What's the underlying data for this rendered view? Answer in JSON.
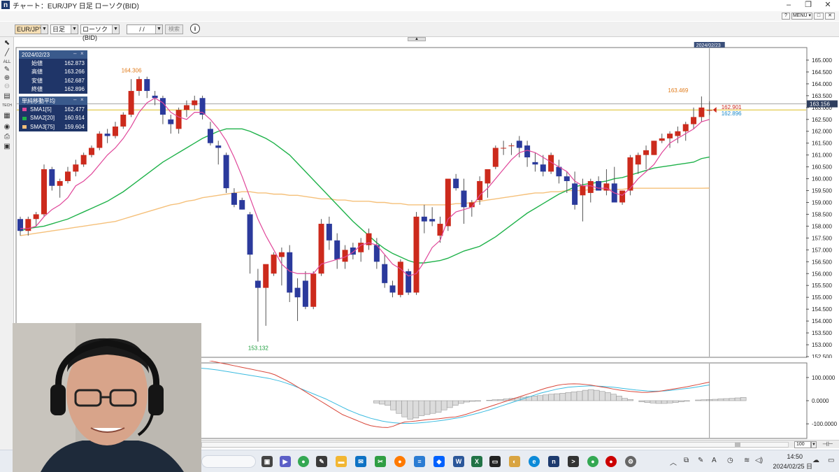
{
  "window": {
    "title": "チャート：EUR/JPY 日足 ローソク(BID)",
    "controls": [
      "?",
      "MENU ▾",
      "□",
      "✕"
    ]
  },
  "toolbar": {
    "symbol": "EUR/JPY",
    "timeframe": "日足",
    "chart_type": "ローソク(BID)",
    "date": "/ /",
    "search_label": "検索",
    "info_icon": "info-icon"
  },
  "ohlc_panel": {
    "date": "2024/02/23",
    "rows": [
      {
        "label": "始値",
        "value": "162.873"
      },
      {
        "label": "高値",
        "value": "163.266"
      },
      {
        "label": "安値",
        "value": "162.687"
      },
      {
        "label": "終値",
        "value": "162.896"
      }
    ]
  },
  "sma_panel": {
    "title": "単純移動平均",
    "rows": [
      {
        "label": "SMA1[5]",
        "value": "162.477",
        "color": "#e0479a"
      },
      {
        "label": "SMA2[20]",
        "value": "160.914",
        "color": "#1fb24a"
      },
      {
        "label": "SMA3[75]",
        "value": "159.604",
        "color": "#f5c07a"
      }
    ]
  },
  "chart_data": [
    {
      "type": "candlestick",
      "symbol": "EUR/JPY",
      "timeframe": "日足",
      "cursor_date_label": "2024/02/23",
      "ylim": [
        152.5,
        165.5
      ],
      "yticks": [
        "165.000",
        "164.500",
        "164.000",
        "163.500",
        "163.000",
        "162.500",
        "162.000",
        "161.500",
        "161.000",
        "160.500",
        "160.000",
        "159.500",
        "159.000",
        "158.500",
        "158.000",
        "157.500",
        "157.000",
        "156.500",
        "156.000",
        "155.500",
        "155.000",
        "154.500",
        "154.000",
        "153.500",
        "153.000",
        "152.500"
      ],
      "current_price_label": "163.156",
      "current_price": 163.156,
      "price_labels": {
        "close": "162.901",
        "sma": "162.896"
      },
      "annotations": [
        {
          "text": "164.306",
          "value": 164.306,
          "index": 14,
          "color": "#e07b1a"
        },
        {
          "text": "153.132",
          "value": 153.132,
          "index": 30,
          "color": "#1a9c3a"
        },
        {
          "text": "163.469",
          "value": 163.469,
          "index": 83,
          "color": "#e07b1a"
        }
      ],
      "up_color": "#cc2a1c",
      "down_color": "#2b3a9c",
      "candles": [
        [
          158.3,
          158.4,
          157.6,
          157.8
        ],
        [
          157.8,
          158.4,
          157.6,
          158.3
        ],
        [
          158.3,
          158.6,
          158.0,
          158.5
        ],
        [
          158.5,
          160.6,
          158.4,
          160.4
        ],
        [
          160.4,
          160.5,
          159.5,
          159.7
        ],
        [
          159.7,
          160.0,
          159.2,
          159.9
        ],
        [
          159.9,
          160.5,
          159.8,
          160.3
        ],
        [
          160.3,
          160.8,
          160.1,
          160.6
        ],
        [
          160.6,
          161.1,
          160.5,
          161.0
        ],
        [
          161.0,
          161.4,
          160.9,
          161.3
        ],
        [
          161.3,
          162.0,
          161.2,
          161.9
        ],
        [
          161.9,
          162.1,
          161.5,
          161.8
        ],
        [
          161.8,
          162.4,
          161.7,
          162.2
        ],
        [
          162.2,
          162.8,
          162.1,
          162.7
        ],
        [
          162.7,
          164.2,
          162.6,
          163.7
        ],
        [
          163.7,
          164.306,
          163.5,
          164.2
        ],
        [
          164.2,
          164.3,
          163.4,
          163.7
        ],
        [
          163.5,
          163.7,
          163.1,
          163.4
        ],
        [
          163.4,
          163.5,
          162.3,
          162.7
        ],
        [
          162.5,
          162.7,
          161.9,
          162.3
        ],
        [
          162.1,
          163.0,
          161.9,
          162.9
        ],
        [
          162.9,
          163.3,
          162.6,
          163.1
        ],
        [
          163.1,
          163.5,
          162.9,
          163.3
        ],
        [
          163.4,
          163.5,
          162.5,
          162.7
        ],
        [
          162.1,
          162.4,
          161.4,
          161.5
        ],
        [
          161.4,
          161.6,
          160.6,
          161.3
        ],
        [
          161.0,
          161.1,
          159.4,
          159.6
        ],
        [
          159.4,
          159.6,
          158.8,
          158.9
        ],
        [
          159.1,
          159.2,
          158.7,
          158.7
        ],
        [
          158.5,
          158.6,
          156.0,
          156.8
        ],
        [
          155.7,
          156.2,
          153.132,
          155.4
        ],
        [
          155.4,
          156.3,
          153.8,
          156.4
        ],
        [
          156.0,
          156.9,
          155.9,
          156.8
        ],
        [
          156.7,
          157.1,
          155.5,
          156.9
        ],
        [
          156.9,
          157.2,
          154.8,
          155.2
        ],
        [
          155.4,
          155.8,
          154.0,
          155.0
        ],
        [
          155.7,
          156.1,
          154.5,
          154.6
        ],
        [
          154.6,
          156.1,
          154.5,
          156.0
        ],
        [
          156.0,
          158.3,
          155.9,
          158.1
        ],
        [
          158.1,
          158.4,
          157.0,
          157.4
        ],
        [
          157.4,
          157.7,
          156.2,
          156.6
        ],
        [
          156.5,
          157.2,
          156.2,
          157.0
        ],
        [
          157.1,
          157.3,
          156.6,
          156.8
        ],
        [
          156.9,
          157.5,
          156.5,
          157.3
        ],
        [
          157.2,
          157.9,
          157.0,
          157.7
        ],
        [
          157.2,
          157.5,
          156.2,
          156.5
        ],
        [
          156.4,
          156.8,
          155.4,
          155.6
        ],
        [
          155.5,
          155.7,
          155.0,
          155.2
        ],
        [
          155.1,
          156.6,
          155.0,
          156.5
        ],
        [
          156.1,
          156.2,
          155.1,
          155.2
        ],
        [
          155.2,
          158.6,
          155.1,
          158.4
        ],
        [
          158.4,
          158.9,
          157.7,
          158.2
        ],
        [
          158.3,
          158.8,
          158.0,
          158.2
        ],
        [
          157.6,
          158.4,
          157.3,
          158.1
        ],
        [
          158.0,
          159.2,
          157.8,
          160.0
        ],
        [
          160.0,
          160.2,
          159.5,
          159.6
        ],
        [
          159.5,
          160.0,
          158.1,
          158.8
        ],
        [
          158.8,
          159.1,
          158.4,
          159.0
        ],
        [
          159.1,
          160.1,
          158.9,
          159.9
        ],
        [
          159.8,
          160.3,
          159.2,
          160.4
        ],
        [
          160.5,
          161.4,
          160.4,
          161.3
        ],
        [
          161.3,
          161.6,
          161.0,
          161.3
        ],
        [
          161.4,
          161.5,
          161.0,
          161.4
        ],
        [
          161.6,
          161.8,
          160.9,
          161.3
        ],
        [
          161.4,
          161.6,
          160.5,
          160.9
        ],
        [
          160.7,
          161.1,
          160.3,
          160.6
        ],
        [
          160.6,
          161.0,
          160.1,
          160.3
        ],
        [
          160.3,
          161.1,
          160.2,
          161.0
        ],
        [
          160.5,
          160.8,
          159.8,
          160.1
        ],
        [
          160.1,
          160.3,
          159.4,
          159.9
        ],
        [
          159.8,
          160.3,
          158.7,
          158.9
        ],
        [
          159.3,
          160.0,
          158.2,
          159.7
        ],
        [
          159.4,
          160.0,
          159.0,
          159.9
        ],
        [
          159.9,
          160.1,
          159.6,
          159.5
        ],
        [
          159.5,
          160.4,
          159.3,
          159.8
        ],
        [
          159.8,
          160.5,
          159.0,
          159.0
        ],
        [
          159.0,
          159.5,
          158.9,
          159.5
        ],
        [
          159.5,
          161.0,
          159.3,
          160.9
        ],
        [
          160.6,
          161.1,
          160.2,
          161.0
        ],
        [
          161.0,
          161.4,
          160.4,
          161.2
        ],
        [
          161.0,
          161.6,
          161.0,
          161.6
        ],
        [
          161.6,
          161.9,
          161.5,
          161.7
        ],
        [
          161.7,
          162.0,
          161.3,
          161.9
        ],
        [
          161.8,
          162.2,
          161.5,
          162.0
        ],
        [
          162.0,
          162.4,
          161.6,
          162.3
        ],
        [
          162.3,
          163.0,
          162.1,
          162.6
        ],
        [
          162.6,
          163.469,
          162.4,
          163.0
        ],
        [
          162.873,
          163.266,
          162.687,
          162.896
        ]
      ],
      "sma1": [
        157.9,
        157.9,
        158.0,
        158.4,
        158.7,
        158.9,
        159.2,
        159.7,
        159.9,
        160.2,
        160.6,
        161.0,
        161.3,
        161.7,
        162.2,
        162.8,
        163.2,
        163.4,
        163.2,
        162.8,
        162.6,
        162.5,
        162.8,
        162.8,
        162.5,
        162.1,
        161.6,
        160.9,
        160.1,
        159.2,
        158.3,
        157.6,
        157.0,
        156.4,
        156.1,
        156.0,
        156.0,
        156.0,
        156.4,
        156.5,
        156.6,
        156.7,
        156.9,
        157.2,
        157.3,
        157.2,
        156.8,
        156.4,
        156.2,
        155.9,
        156.0,
        156.5,
        157.1,
        157.4,
        158.3,
        158.6,
        158.7,
        158.8,
        159.3,
        159.6,
        160.0,
        160.4,
        160.8,
        161.1,
        161.2,
        161.1,
        160.9,
        160.7,
        160.5,
        160.3,
        159.9,
        159.7,
        159.7,
        159.6,
        159.6,
        159.4,
        159.3,
        159.6,
        160.0,
        160.3,
        160.6,
        161.1,
        161.5,
        161.7,
        161.9,
        162.1,
        162.4,
        162.5
      ],
      "sma2": [
        157.8,
        157.9,
        157.95,
        158.0,
        158.1,
        158.2,
        158.3,
        158.45,
        158.6,
        158.75,
        158.9,
        159.05,
        159.25,
        159.45,
        159.7,
        159.95,
        160.2,
        160.45,
        160.7,
        160.9,
        161.1,
        161.3,
        161.5,
        161.7,
        161.85,
        162.0,
        162.1,
        162.1,
        162.1,
        162.0,
        161.85,
        161.7,
        161.5,
        161.25,
        161.0,
        160.65,
        160.3,
        159.95,
        159.6,
        159.25,
        158.9,
        158.55,
        158.2,
        157.9,
        157.6,
        157.3,
        157.05,
        156.85,
        156.7,
        156.55,
        156.45,
        156.45,
        156.5,
        156.55,
        156.65,
        156.8,
        156.95,
        157.05,
        157.15,
        157.35,
        157.55,
        157.8,
        158.05,
        158.3,
        158.55,
        158.75,
        158.95,
        159.15,
        159.35,
        159.5,
        159.65,
        159.75,
        159.8,
        159.85,
        159.9,
        160.0,
        160.05,
        160.15,
        160.25,
        160.35,
        160.45,
        160.5,
        160.55,
        160.6,
        160.65,
        160.7,
        160.85,
        160.914
      ],
      "sma3": [
        157.6,
        157.65,
        157.7,
        157.75,
        157.8,
        157.85,
        157.9,
        157.95,
        158.0,
        158.05,
        158.1,
        158.15,
        158.2,
        158.3,
        158.4,
        158.5,
        158.6,
        158.7,
        158.8,
        158.9,
        158.95,
        159.05,
        159.1,
        159.2,
        159.25,
        159.3,
        159.35,
        159.4,
        159.45,
        159.45,
        159.4,
        159.4,
        159.35,
        159.35,
        159.3,
        159.3,
        159.25,
        159.2,
        159.15,
        159.15,
        159.1,
        159.1,
        159.05,
        159.05,
        159.05,
        159.0,
        159.0,
        158.95,
        158.95,
        158.9,
        158.9,
        158.9,
        158.9,
        158.9,
        158.9,
        158.95,
        158.95,
        159.0,
        159.05,
        159.1,
        159.15,
        159.2,
        159.25,
        159.3,
        159.35,
        159.4,
        159.4,
        159.45,
        159.45,
        159.5,
        159.5,
        159.5,
        159.55,
        159.55,
        159.55,
        159.55,
        159.55,
        159.6,
        159.6,
        159.6,
        159.6,
        159.6,
        159.6,
        159.6,
        159.6,
        159.6,
        159.6,
        159.604
      ]
    },
    {
      "type": "macd",
      "ylim": [
        -160,
        160
      ],
      "yticks": [
        "100.0000",
        "0.0000",
        "-100.0000"
      ],
      "zoom": "100",
      "histogram": [
        0,
        0,
        0,
        0,
        0,
        0,
        0,
        0,
        0,
        0,
        0,
        0,
        0,
        0,
        0,
        0,
        0,
        0,
        0,
        0,
        0,
        0,
        0,
        0,
        0,
        0,
        0,
        0,
        0,
        0,
        0,
        -10,
        -15,
        -20,
        -40,
        -55,
        -70,
        -80,
        -75,
        -65,
        -60,
        -55,
        -50,
        -40,
        -30,
        -20,
        -12,
        -6,
        -3,
        -2,
        0,
        2,
        4,
        5,
        8,
        10,
        12,
        15,
        18,
        20,
        22,
        25,
        28,
        30,
        32,
        35,
        38,
        40,
        45,
        48,
        45,
        40,
        35,
        28,
        20,
        10,
        5,
        0,
        -5,
        -8,
        -10,
        -12,
        -12,
        -10,
        -8,
        -5,
        -2,
        0,
        3,
        4,
        5,
        6,
        8,
        9,
        10,
        12,
        14
      ],
      "macd": [
        180,
        175,
        170,
        165,
        160,
        155,
        150,
        145,
        140,
        135,
        130,
        125,
        120,
        112,
        100,
        88,
        75,
        60,
        45,
        30,
        15,
        0,
        -15,
        -30,
        -45,
        -60,
        -70,
        -80,
        -90,
        -100,
        -108,
        -112,
        -115,
        -116,
        -110,
        -100,
        -92,
        -90,
        -88,
        -85,
        -82,
        -80,
        -78,
        -75,
        -72,
        -70,
        -65,
        -58,
        -50,
        -42,
        -34,
        -26,
        -18,
        -10,
        -2,
        6,
        14,
        22,
        30,
        38,
        46,
        54,
        60,
        66,
        70,
        72,
        73,
        72,
        70,
        67,
        63,
        59,
        55,
        50,
        46,
        43,
        40,
        38,
        36,
        36,
        38,
        40,
        44,
        48,
        52,
        56,
        60,
        65,
        70,
        75,
        80
      ],
      "signal": [
        140,
        138,
        135,
        132,
        128,
        124,
        120,
        116,
        112,
        108,
        104,
        100,
        96,
        90,
        84,
        76,
        68,
        58,
        48,
        38,
        28,
        18,
        8,
        -4,
        -16,
        -28,
        -40,
        -50,
        -60,
        -68,
        -76,
        -82,
        -88,
        -92,
        -95,
        -97,
        -98,
        -98,
        -97,
        -95,
        -93,
        -90,
        -87,
        -84,
        -80,
        -76,
        -72,
        -66,
        -60,
        -54,
        -47,
        -40,
        -32,
        -24,
        -16,
        -8,
        0,
        8,
        16,
        24,
        32,
        38,
        44,
        50,
        54,
        58,
        60,
        62,
        63,
        64,
        63,
        62,
        60,
        58,
        55,
        52,
        49,
        46,
        44,
        42,
        41,
        41,
        42,
        44,
        47,
        50,
        53,
        56,
        60,
        64,
        68
      ]
    }
  ],
  "bottom_scroll": {
    "zoom_value": "100"
  },
  "taskbar": {
    "time": "14:50",
    "date": "2024/02/25 日",
    "tray_icons": [
      "chevron-up-icon",
      "network-icon",
      "pen-icon",
      "clock-icon",
      "wifi-icon",
      "volume-icon",
      "cloud-icon"
    ]
  }
}
